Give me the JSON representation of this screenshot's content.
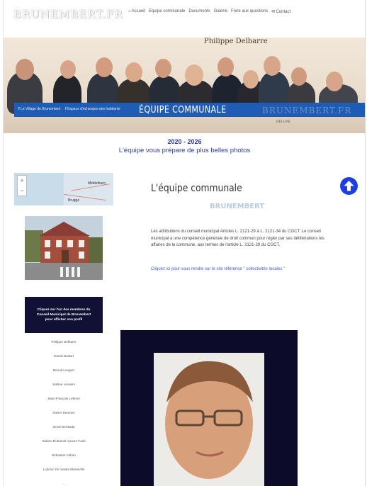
{
  "header": {
    "logo": "BRUNEMBERT.FR",
    "nav": [
      {
        "icon": "home-icon",
        "glyph": "⌂",
        "label": "Accueil"
      },
      {
        "icon": "",
        "glyph": "",
        "label": "Equipe communale"
      },
      {
        "icon": "",
        "glyph": "",
        "label": "Documents"
      },
      {
        "icon": "",
        "glyph": "",
        "label": "Galerie"
      },
      {
        "icon": "",
        "glyph": "",
        "label": "Foire aux questions"
      },
      {
        "icon": "envelope-icon",
        "glyph": "✉",
        "label": "Contact"
      }
    ]
  },
  "banner": {
    "signature": "Philippe Delbarre",
    "website": "WWW.BRUNEMBERT.FR",
    "links": [
      "Le Village de Brunembert",
      "Espace d'échanges des habitants"
    ],
    "title": "ÉQUIPE COMMUNALE",
    "watermark": "BRUNEMBERT.FR",
    "shirt_text": "DELUXE"
  },
  "headline": {
    "years": "2020 - 2026",
    "subtitle": "L'équipe vous prépare de plus belles photos"
  },
  "map": {
    "labels": [
      "Middelburg",
      "Brugge"
    ]
  },
  "content": {
    "title": "L'équipe communale",
    "subtitle": "BRUNEMBERT",
    "paragraph": "Les attributions du conseil municipal Articles L. 2121-29 à L. 2121-34 du CGCT. Le conseil municipal a une compétence générale de droit commun pour régler par ses délibérations les affaires de la commune, aux termes de l'article L. 2121-29 du CGCT.",
    "link": "Cliquez ici pour vous rendre sur le site référence \" collectivités locales \""
  },
  "members": {
    "header": "Cliquez sur l'un des membres du Conseil Municipal de Brunembert pour afficher son profil",
    "list": [
      "Philippe Delbarre",
      "Daniel Bodart",
      "Benoit Lougart",
      "Justine Lemaire",
      "Jean-François Lefevre",
      "Xavier Heumez",
      "Omar Benkada",
      "Sabine Dubamel Apourn Fault",
      "Sébastien Hibon",
      "Ludovic De Sainte Marreville",
      "..."
    ]
  },
  "colors": {
    "accent_blue": "#1f5cb5",
    "heading_blue": "#2b3aa3",
    "link_blue": "#3d59d6",
    "panel_navy": "#111135",
    "scroll_top_button": "#1e3fe0"
  }
}
